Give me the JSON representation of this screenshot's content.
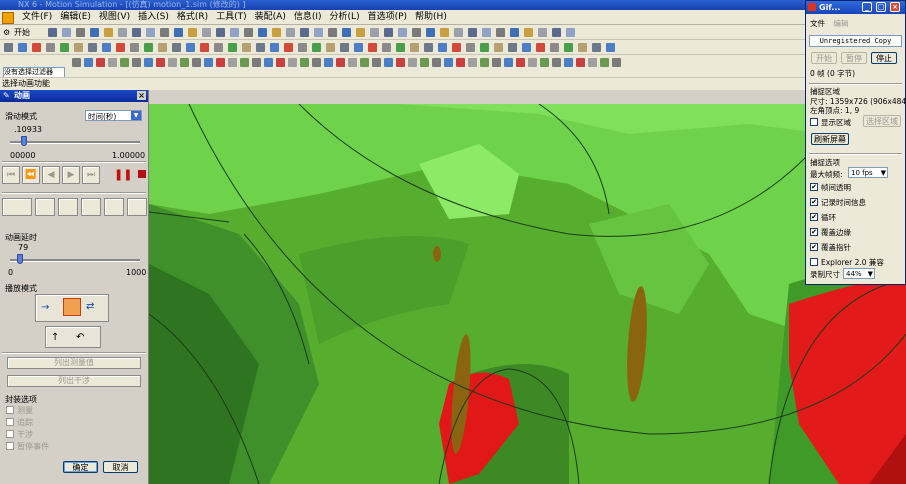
{
  "window": {
    "title": "NX 6 - Motion Simulation - [(仿真) motion_1.sim (修改的) ]"
  },
  "menu": [
    "文件(F)",
    "编辑(E)",
    "视图(V)",
    "插入(S)",
    "格式(R)",
    "工具(T)",
    "装配(A)",
    "信息(I)",
    "分析(L)",
    "首选项(P)",
    "帮助(H)"
  ],
  "toolbar": {
    "start_label": "开始",
    "cmd_box": "没有选择过滤器",
    "select_bar": "选择动画功能"
  },
  "anim": {
    "title": "动画",
    "slide_mode_label": "滑动模式",
    "slide_mode_value": "时间(秒)",
    "time_value": ".10933",
    "range_min": "00000",
    "range_max": "1.00000",
    "time_fraction": 0.10933,
    "delay_label": "动画延时",
    "delay_value": "79",
    "delay_min": "0",
    "delay_max": "1000",
    "delay_fraction": 0.079,
    "play_mode_label": "播放模式",
    "list_btn1": "列出测量值",
    "list_btn2": "列出干涉",
    "package_label": "封装选项",
    "options": [
      "测量",
      "追踪",
      "干涉",
      "暂停事件"
    ],
    "ok_label": "确定",
    "cancel_label": "取消"
  },
  "gif": {
    "title": "Gif...",
    "menu": [
      "文件",
      "编辑"
    ],
    "banner": "Unregistered Copy",
    "start_btn": "开始",
    "pause_btn": "暂停",
    "stop_btn": "停止",
    "frames": "0 帧 (0 字节)",
    "capture_area_title": "捕捉区域",
    "size_label": "尺寸:",
    "size_value": "1359x726 (906x484)",
    "origin_label": "左角顶点:",
    "origin_value": "1, 9",
    "show_area": "显示区域",
    "select_area": "选择区域",
    "refresh": "刷新屏幕",
    "capture_opts_title": "捕捉选项",
    "max_fps_label": "最大帧频:",
    "max_fps_value": "10 fps",
    "opts": [
      {
        "label": "帧间透明",
        "checked": true
      },
      {
        "label": "记录时间信息",
        "checked": true
      },
      {
        "label": "循环",
        "checked": true
      },
      {
        "label": "覆盖边缘",
        "checked": true
      },
      {
        "label": "覆盖指针",
        "checked": true
      },
      {
        "label": "Explorer 2.0 兼容",
        "checked": false
      }
    ],
    "rec_size_label": "录制尺寸",
    "rec_size_value": "44%"
  },
  "colors": {
    "green": "#55b82c",
    "light_green": "#80e060",
    "dark_green": "#2e7d22",
    "red": "#e01818",
    "brown": "#8a6410"
  }
}
